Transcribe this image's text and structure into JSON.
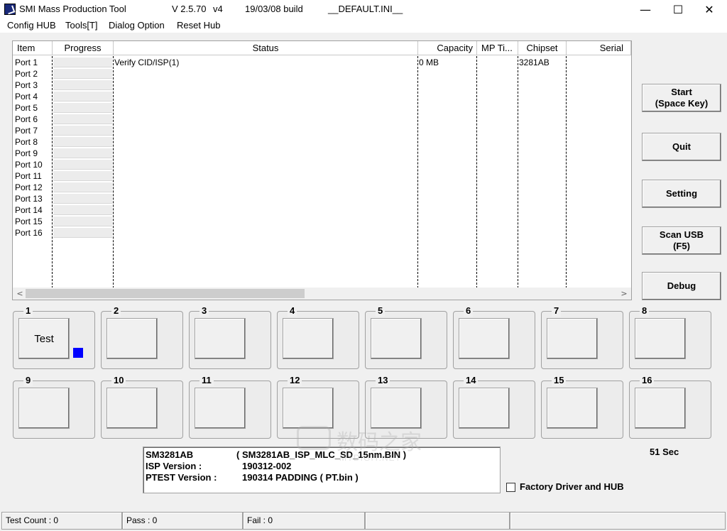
{
  "window": {
    "app_name": "SMI Mass Production Tool",
    "version": "V 2.5.70",
    "version_suffix": "v4",
    "build": "19/03/08 build",
    "ini": "__DEFAULT.INI__",
    "min_glyph": "—",
    "max_glyph": "☐",
    "close_glyph": "✕"
  },
  "menu": [
    "Config HUB",
    "Tools[T]",
    "Dialog Option",
    "Reset Hub"
  ],
  "list": {
    "columns": [
      "Item",
      "Progress",
      "Status",
      "Capacity",
      "MP Ti...",
      "Chipset",
      "Serial"
    ],
    "rows": [
      {
        "item": "Port 1",
        "status": "Verify CID/ISP(1)",
        "capacity": "0 MB",
        "chipset": "3281AB"
      },
      {
        "item": "Port 2"
      },
      {
        "item": "Port 3"
      },
      {
        "item": "Port 4"
      },
      {
        "item": "Port 5"
      },
      {
        "item": "Port 6"
      },
      {
        "item": "Port 7"
      },
      {
        "item": "Port 8"
      },
      {
        "item": "Port 9"
      },
      {
        "item": "Port 10"
      },
      {
        "item": "Port 11"
      },
      {
        "item": "Port 12"
      },
      {
        "item": "Port 13"
      },
      {
        "item": "Port 14"
      },
      {
        "item": "Port 15"
      },
      {
        "item": "Port 16"
      }
    ],
    "scroll_left": "<",
    "scroll_right": ">"
  },
  "buttons": {
    "start_line1": "Start",
    "start_line2": "(Space Key)",
    "quit": "Quit",
    "setting": "Setting",
    "scan_line1": "Scan USB",
    "scan_line2": "(F5)",
    "debug": "Debug"
  },
  "ports": [
    {
      "num": "1",
      "label": "Test",
      "indicator_color": "#0000ff"
    },
    {
      "num": "2",
      "label": ""
    },
    {
      "num": "3",
      "label": ""
    },
    {
      "num": "4",
      "label": ""
    },
    {
      "num": "5",
      "label": ""
    },
    {
      "num": "6",
      "label": ""
    },
    {
      "num": "7",
      "label": ""
    },
    {
      "num": "8",
      "label": ""
    },
    {
      "num": "9",
      "label": ""
    },
    {
      "num": "10",
      "label": ""
    },
    {
      "num": "11",
      "label": ""
    },
    {
      "num": "12",
      "label": ""
    },
    {
      "num": "13",
      "label": ""
    },
    {
      "num": "14",
      "label": ""
    },
    {
      "num": "15",
      "label": ""
    },
    {
      "num": "16",
      "label": ""
    }
  ],
  "info": {
    "chip": "SM3281AB",
    "chip_file": "( SM3281AB_ISP_MLC_SD_15nm.BIN )",
    "isp_label": "ISP Version :",
    "isp_value": "190312-002",
    "ptest_label": "PTEST Version :",
    "ptest_value": "190314 PADDING  ( PT.bin )"
  },
  "timer": "51 Sec",
  "factory_checkbox": {
    "label": "Factory Driver and HUB",
    "checked": false
  },
  "statusbar": {
    "test_count": "Test Count : 0",
    "pass": "Pass : 0",
    "fail": "Fail : 0"
  },
  "watermark": {
    "text": "数码之家",
    "sub": "MYDIGIT.NET"
  }
}
